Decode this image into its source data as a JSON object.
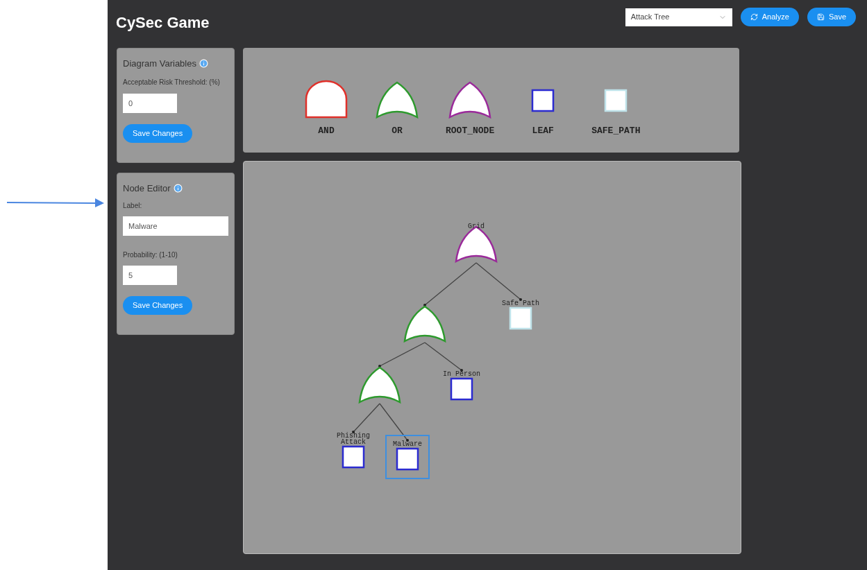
{
  "app": {
    "title": "CySec Game"
  },
  "toolbar": {
    "diagram_type": "Attack Tree",
    "buttons": [
      {
        "kind": "analyze",
        "label": "Analyze"
      },
      {
        "kind": "save",
        "label": "Save"
      }
    ]
  },
  "diagram_variables": {
    "title": "Diagram Variables",
    "field_label": "Acceptable Risk Threshold: (%)",
    "value": "0",
    "button": "Save Changes"
  },
  "node_editor": {
    "title": "Node Editor",
    "label_label": "Label:",
    "label_value": "Malware",
    "probability_label": "Probability: (1-10)",
    "probability_value": "5",
    "button": "Save Changes"
  },
  "legend": [
    {
      "kind": "and",
      "label": "AND"
    },
    {
      "kind": "or",
      "label": "OR"
    },
    {
      "kind": "root",
      "label": "ROOT_NODE"
    },
    {
      "kind": "leaf",
      "label": "LEAF"
    },
    {
      "kind": "safe",
      "label": "SAFE_PATH"
    }
  ],
  "tree": {
    "kind": "root",
    "label": "Grid",
    "selected": false,
    "children": [
      {
        "kind": "or",
        "selected": false,
        "children": [
          {
            "kind": "or",
            "selected": false,
            "children": [
              {
                "kind": "leaf",
                "label": "Phishing Attack",
                "selected": false
              },
              {
                "kind": "leaf",
                "label": "Malware",
                "selected": true
              }
            ]
          },
          {
            "kind": "leaf",
            "label": "In Person",
            "selected": false
          }
        ]
      },
      {
        "kind": "safe",
        "label": "Safe Path",
        "selected": false
      }
    ]
  }
}
